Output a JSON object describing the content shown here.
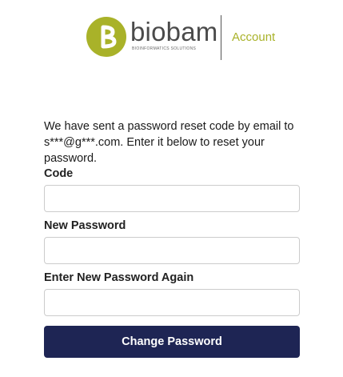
{
  "header": {
    "brand_name": "biobam",
    "brand_tagline": "BIOINFORMATICS SOLUTIONS",
    "section_label": "Account",
    "brand_color": "#a9b229",
    "logo_icon": "biobam-logo-icon"
  },
  "form": {
    "message": "We have sent a password reset code by email to s***@g***.com. Enter it below to reset your password.",
    "fields": [
      {
        "label": "Code",
        "value": "",
        "placeholder": ""
      },
      {
        "label": "New Password",
        "value": "",
        "placeholder": ""
      },
      {
        "label": "Enter New Password Again",
        "value": "",
        "placeholder": ""
      }
    ],
    "submit_label": "Change Password",
    "button_color": "#1e2554"
  }
}
